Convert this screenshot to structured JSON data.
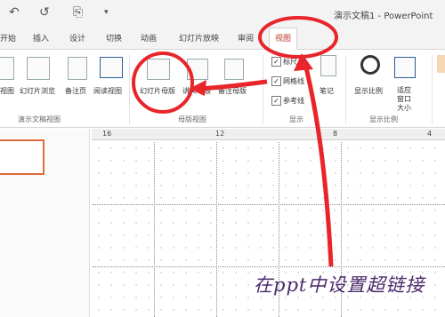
{
  "quick_access": {
    "undo": "↶",
    "redo": "↺",
    "save": "⎘",
    "more": "▾"
  },
  "window": {
    "title": "演示文稿1 - PowerPoint"
  },
  "tabs": [
    {
      "label": "开始"
    },
    {
      "label": "插入"
    },
    {
      "label": "设计"
    },
    {
      "label": "切换"
    },
    {
      "label": "动画"
    },
    {
      "label": "幻灯片放映"
    },
    {
      "label": "审阅"
    },
    {
      "label": "视图"
    }
  ],
  "ribbon": {
    "presentation_views": {
      "items": [
        {
          "label": "视图"
        },
        {
          "label": "幻灯片浏览"
        },
        {
          "label": "备注页"
        },
        {
          "label": "阅读视图"
        }
      ],
      "group_label": "演示文稿视图"
    },
    "master_views": {
      "items": [
        {
          "label": "幻灯片母版"
        },
        {
          "label": "讲义母版"
        },
        {
          "label": "备注母版"
        }
      ],
      "group_label": "母版视图"
    },
    "show": {
      "items": [
        {
          "label": "标尺",
          "checked": true
        },
        {
          "label": "网格线",
          "checked": true
        },
        {
          "label": "参考线",
          "checked": true
        }
      ],
      "notes_label": "笔记",
      "group_label": "显示"
    },
    "zoom": {
      "items": [
        {
          "label": "显示比例"
        },
        {
          "label": "适应窗口大小"
        }
      ],
      "group_label": "显示比例"
    }
  },
  "ruler": {
    "left": "16",
    "mid": "12",
    "right": "8",
    "r2": "4"
  },
  "thumbnail": {
    "number": "1"
  },
  "caption": "在ppt中设置超链接",
  "annotation_color": "#e8252a"
}
